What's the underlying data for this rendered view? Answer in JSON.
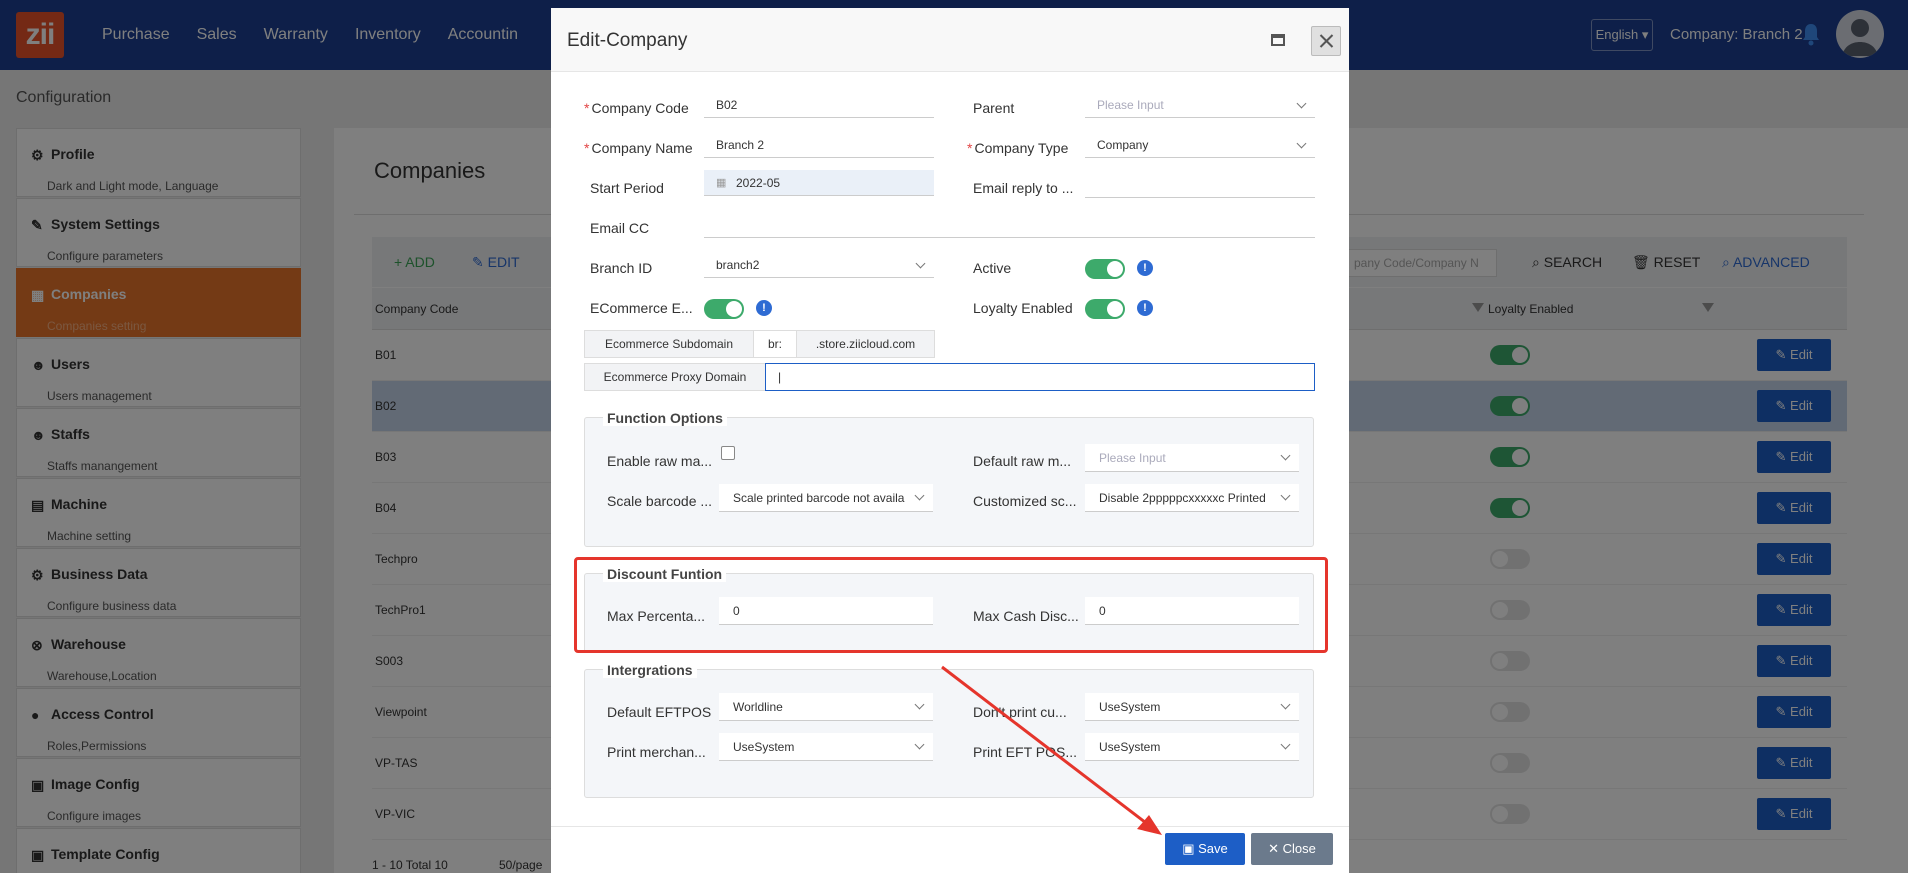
{
  "topbar": {
    "logo": "zii",
    "nav": [
      "Purchase",
      "Sales",
      "Warranty",
      "Inventory",
      "Accountin"
    ],
    "language": "English",
    "company": "Company: Branch 2"
  },
  "page": {
    "title": "Configuration"
  },
  "sidebar": {
    "items": [
      {
        "label": "Profile",
        "sub": "Dark and Light mode, Language",
        "icon": "gear-icon"
      },
      {
        "label": "System Settings",
        "sub": "Configure parameters",
        "icon": "wrench-icon"
      },
      {
        "label": "Companies",
        "sub": "Companies setting",
        "icon": "building-icon"
      },
      {
        "label": "Users",
        "sub": "Users management",
        "icon": "users-icon"
      },
      {
        "label": "Staffs",
        "sub": "Staffs manangement",
        "icon": "users-icon"
      },
      {
        "label": "Machine",
        "sub": "Machine setting",
        "icon": "machine-icon"
      },
      {
        "label": "Business Data",
        "sub": "Configure business data",
        "icon": "gear-icon"
      },
      {
        "label": "Warehouse",
        "sub": "Warehouse,Location",
        "icon": "warehouse-icon"
      },
      {
        "label": "Access Control",
        "sub": "Roles,Permissions",
        "icon": "key-icon"
      },
      {
        "label": "Image Config",
        "sub": "Configure images",
        "icon": "image-icon"
      },
      {
        "label": "Template Config",
        "sub": "",
        "icon": "template-icon"
      }
    ]
  },
  "main": {
    "title": "Companies",
    "toolbar": {
      "add": "+ ADD",
      "edit": "EDIT",
      "search_placeholder": "pany Code/Company N",
      "search": "SEARCH",
      "reset": "RESET",
      "advanced": "ADVANCED SEARCH"
    },
    "columns": {
      "code": "Company Code",
      "loyalty": "Loyalty Enabled"
    },
    "rows": [
      {
        "code": "B01",
        "loyalty": true
      },
      {
        "code": "B02",
        "loyalty": true
      },
      {
        "code": "B03",
        "loyalty": true
      },
      {
        "code": "B04",
        "loyalty": true
      },
      {
        "code": "Techpro",
        "loyalty": false
      },
      {
        "code": "TechPro1",
        "loyalty": false
      },
      {
        "code": "S003",
        "loyalty": false
      },
      {
        "code": "Viewpoint",
        "loyalty": false
      },
      {
        "code": "VP-TAS",
        "loyalty": false
      },
      {
        "code": "VP-VIC",
        "loyalty": false
      }
    ],
    "row_edit_label": "Edit",
    "pager": {
      "total": "1 - 10 Total 10",
      "per_page": "50/page"
    }
  },
  "modal": {
    "title": "Edit-Company",
    "fields": {
      "company_code": {
        "label": "Company Code",
        "value": "B02"
      },
      "parent": {
        "label": "Parent",
        "placeholder": "Please Input"
      },
      "company_name": {
        "label": "Company Name",
        "value": "Branch 2"
      },
      "company_type": {
        "label": "Company Type",
        "value": "Company"
      },
      "start_period": {
        "label": "Start Period",
        "value": "2022-05"
      },
      "email_reply": {
        "label": "Email reply to ...",
        "value": ""
      },
      "email_cc": {
        "label": "Email CC",
        "value": ""
      },
      "branch_id": {
        "label": "Branch ID",
        "value": "branch2"
      },
      "active": {
        "label": "Active"
      },
      "ecommerce": {
        "label": "ECommerce E..."
      },
      "loyalty": {
        "label": "Loyalty Enabled"
      },
      "ecom_subdomain": {
        "label": "Ecommerce Subdomain",
        "value": "br:",
        "suffix": ".store.ziicloud.com"
      },
      "ecom_proxy": {
        "label": "Ecommerce Proxy Domain",
        "value": "|"
      }
    },
    "function_options": {
      "legend": "Function Options",
      "enable_raw": {
        "label": "Enable raw ma..."
      },
      "default_raw": {
        "label": "Default raw m...",
        "placeholder": "Please Input"
      },
      "scale_barcode": {
        "label": "Scale barcode ...",
        "value": "Scale printed barcode not availa"
      },
      "customized": {
        "label": "Customized sc...",
        "value": "Disable 2pppppcxxxxxc Printed"
      }
    },
    "discount": {
      "legend": "Discount Funtion",
      "max_pct": {
        "label": "Max Percenta...",
        "value": "0"
      },
      "max_cash": {
        "label": "Max Cash Disc...",
        "value": "0"
      }
    },
    "integrations": {
      "legend": "Intergrations",
      "default_eftpos": {
        "label": "Default EFTPOS",
        "value": "Worldline"
      },
      "dont_print": {
        "label": "Don't print cu...",
        "value": "UseSystem"
      },
      "print_merchant": {
        "label": "Print merchan...",
        "value": "UseSystem"
      },
      "print_eft": {
        "label": "Print EFT POS...",
        "value": "UseSystem"
      }
    },
    "buttons": {
      "save": "Save",
      "close": "Close"
    }
  },
  "colors": {
    "brand": "#1c3f92",
    "accent": "#e8742a",
    "highlight": "#e5352c",
    "primary_button": "#1d5ec6"
  }
}
